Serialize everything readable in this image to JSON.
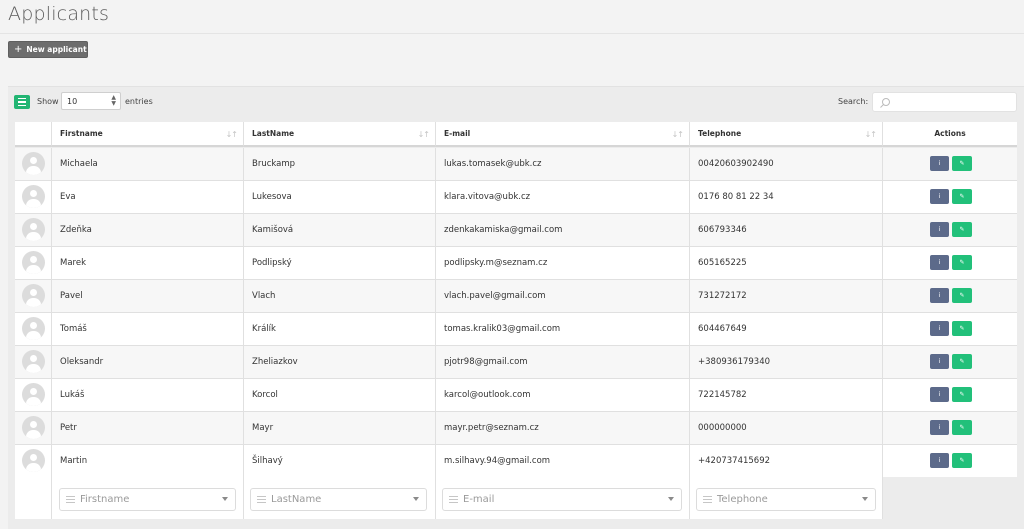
{
  "page": {
    "title": "Applicants"
  },
  "toolbar": {
    "new_label": "New applicant"
  },
  "table_controls": {
    "show_label": "Show",
    "length_value": "10",
    "entries_label": "entries",
    "search_label": "Search:",
    "search_value": ""
  },
  "columns": {
    "firstname": "Firstname",
    "lastname": "LastName",
    "email": "E-mail",
    "telephone": "Telephone",
    "actions": "Actions"
  },
  "rows": [
    {
      "firstname": "Michaela",
      "lastname": "Bruckamp",
      "email": "lukas.tomasek@ubk.cz",
      "telephone": "00420603902490"
    },
    {
      "firstname": "Eva",
      "lastname": "Lukesova",
      "email": "klara.vitova@ubk.cz",
      "telephone": "0176 80 81 22 34"
    },
    {
      "firstname": "Zdeňka",
      "lastname": "Kamišová",
      "email": "zdenkakamiska@gmail.com",
      "telephone": "606793346"
    },
    {
      "firstname": "Marek",
      "lastname": "Podlipský",
      "email": "podlipsky.m@seznam.cz",
      "telephone": "605165225"
    },
    {
      "firstname": "Pavel",
      "lastname": "Vlach",
      "email": "vlach.pavel@gmail.com",
      "telephone": "731272172"
    },
    {
      "firstname": "Tomáš",
      "lastname": "Králík",
      "email": "tomas.kralik03@gmail.com",
      "telephone": "604467649"
    },
    {
      "firstname": "Oleksandr",
      "lastname": "Zheliazkov",
      "email": "pjotr98@gmail.com",
      "telephone": "+380936179340"
    },
    {
      "firstname": "Lukáš",
      "lastname": "Korcol",
      "email": "karcol@outlook.com",
      "telephone": "722145782"
    },
    {
      "firstname": "Petr",
      "lastname": "Mayr",
      "email": "mayr.petr@seznam.cz",
      "telephone": "000000000"
    },
    {
      "firstname": "Martin",
      "lastname": "Šilhavý",
      "email": "m.silhavy.94@gmail.com",
      "telephone": "+420737415692"
    }
  ],
  "filters": {
    "firstname": "Firstname",
    "lastname": "LastName",
    "email": "E-mail",
    "telephone": "Telephone"
  },
  "icons": {
    "new": "plus-icon",
    "view": "list-icon",
    "search": "search-icon",
    "avatar": "user-avatar-icon",
    "info": "info-icon",
    "edit": "edit-icon",
    "sort": "sort-icon",
    "filter": "filter-list-icon"
  },
  "colors": {
    "accent_green": "#22c07a",
    "info_blue": "#5c6a8a",
    "dark_button": "#6d6d6d"
  }
}
